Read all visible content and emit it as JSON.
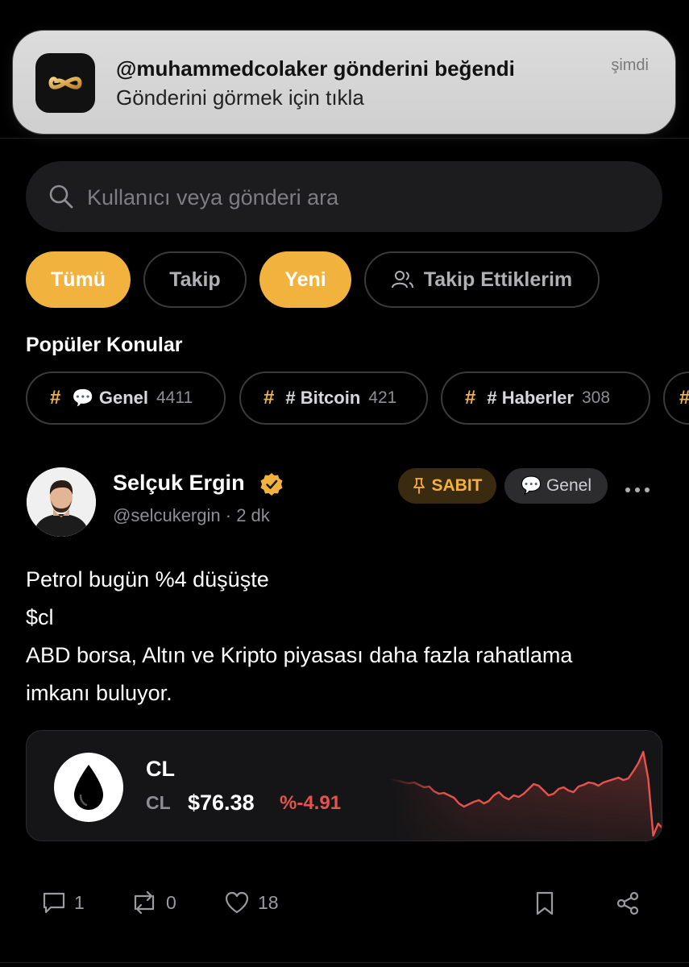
{
  "notification": {
    "title": "@muhammedcolaker gönderini beğendi",
    "subtitle": "Gönderini görmek için tıkla",
    "time": "şimdi",
    "app_icon": "infinity-logo-icon"
  },
  "search": {
    "placeholder": "Kullanıcı veya gönderi ara"
  },
  "filters": [
    {
      "label": "Tümü",
      "active": true
    },
    {
      "label": "Takip",
      "active": false
    },
    {
      "label": "Yeni",
      "active": true
    },
    {
      "label": "Takip Ettiklerim",
      "active": false,
      "icon": "users-icon"
    }
  ],
  "popular_topics": {
    "title": "Popüler Konular",
    "items": [
      {
        "label": "💬 Genel",
        "count": "4411"
      },
      {
        "label": "# Bitcoin",
        "count": "421"
      },
      {
        "label": "# Haberler",
        "count": "308"
      }
    ]
  },
  "post": {
    "author_name": "Selçuk Ergin",
    "author_handle": "@selcukergin",
    "time": "· 2 dk",
    "verified": true,
    "pin_label": "SABIT",
    "category_label": "💬 Genel",
    "text_lines": [
      "Petrol bugün %4 düşüşte",
      "$cl",
      "ABD borsa, Altın ve Kripto piyasası daha fazla rahatlama",
      "imkanı buluyor."
    ],
    "ticker": {
      "symbol": "CL",
      "sub_symbol": "CL",
      "price": "$76.38",
      "change": "%-4.91",
      "change_color": "#e5534b",
      "sparkline": [
        40,
        41,
        42,
        44,
        45,
        44,
        47,
        50,
        49,
        55,
        58,
        57,
        60,
        63,
        70,
        74,
        71,
        68,
        66,
        70,
        67,
        60,
        56,
        62,
        65,
        60,
        62,
        58,
        52,
        46,
        48,
        54,
        60,
        58,
        52,
        50,
        54,
        56,
        49,
        47,
        44,
        45,
        48,
        44,
        42,
        40,
        38,
        41,
        39,
        30,
        20,
        6,
        40,
        110,
        95,
        102
      ]
    },
    "actions": {
      "comments": "1",
      "reposts": "0",
      "likes": "18"
    }
  },
  "colors": {
    "accent": "#f2b23e",
    "background": "#000000",
    "negative": "#e5534b"
  }
}
